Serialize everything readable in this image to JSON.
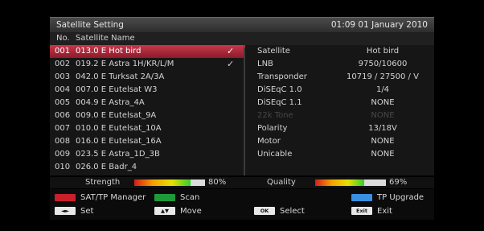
{
  "header": {
    "title": "Satellite Setting",
    "clock": "01:09 01 January 2010"
  },
  "columns": {
    "no": "No.",
    "name": "Satellite Name"
  },
  "satellites": [
    {
      "no": "001",
      "name": "013.0 E Hot bird",
      "checked": true,
      "selected": true
    },
    {
      "no": "002",
      "name": "019.2 E Astra 1H/KR/L/M",
      "checked": true,
      "selected": false
    },
    {
      "no": "003",
      "name": "042.0 E Turksat 2A/3A",
      "checked": false,
      "selected": false
    },
    {
      "no": "004",
      "name": "007.0 E Eutelsat W3",
      "checked": false,
      "selected": false
    },
    {
      "no": "005",
      "name": "004.9 E Astra_4A",
      "checked": false,
      "selected": false
    },
    {
      "no": "006",
      "name": "009.0 E Eutelsat_9A",
      "checked": false,
      "selected": false
    },
    {
      "no": "007",
      "name": "010.0 E Eutelsat_10A",
      "checked": false,
      "selected": false
    },
    {
      "no": "008",
      "name": "016.0 E Eutelsat_16A",
      "checked": false,
      "selected": false
    },
    {
      "no": "009",
      "name": "023.5 E Astra_1D_3B",
      "checked": false,
      "selected": false
    },
    {
      "no": "010",
      "name": "026.0 E Badr_4",
      "checked": false,
      "selected": false
    }
  ],
  "check_glyph": "✓",
  "details": [
    {
      "label": "Satellite",
      "value": "Hot bird",
      "enabled": true
    },
    {
      "label": "LNB",
      "value": "9750/10600",
      "enabled": true
    },
    {
      "label": "Transponder",
      "value": "10719 / 27500 / V",
      "enabled": true
    },
    {
      "label": "DiSEqC 1.0",
      "value": "1/4",
      "enabled": true
    },
    {
      "label": "DiSEqC 1.1",
      "value": "NONE",
      "enabled": true
    },
    {
      "label": "22k Tone",
      "value": "NONE",
      "enabled": false
    },
    {
      "label": "Polarity",
      "value": "13/18V",
      "enabled": true
    },
    {
      "label": "Motor",
      "value": "NONE",
      "enabled": true
    },
    {
      "label": "Unicable",
      "value": "NONE",
      "enabled": true
    }
  ],
  "signal": {
    "strength_label": "Strength",
    "strength_pct": "80%",
    "strength_value": 0.8,
    "quality_label": "Quality",
    "quality_pct": "69%",
    "quality_value": 0.69
  },
  "footer": {
    "red_label": "SAT/TP Manager",
    "green_label": "Scan",
    "blue_label": "TP Upgrade",
    "set_key": "◄►",
    "set_label": "Set",
    "move_key": "▲▼",
    "move_label": "Move",
    "ok_key": "OK",
    "select_label": "Select",
    "exit_key": "Exit",
    "exit_label": "Exit"
  },
  "colors": {
    "red_key": "#c8202c",
    "green_key": "#1e9a3c",
    "blue_key": "#3a8fe0",
    "selection": "#b02a3c"
  }
}
